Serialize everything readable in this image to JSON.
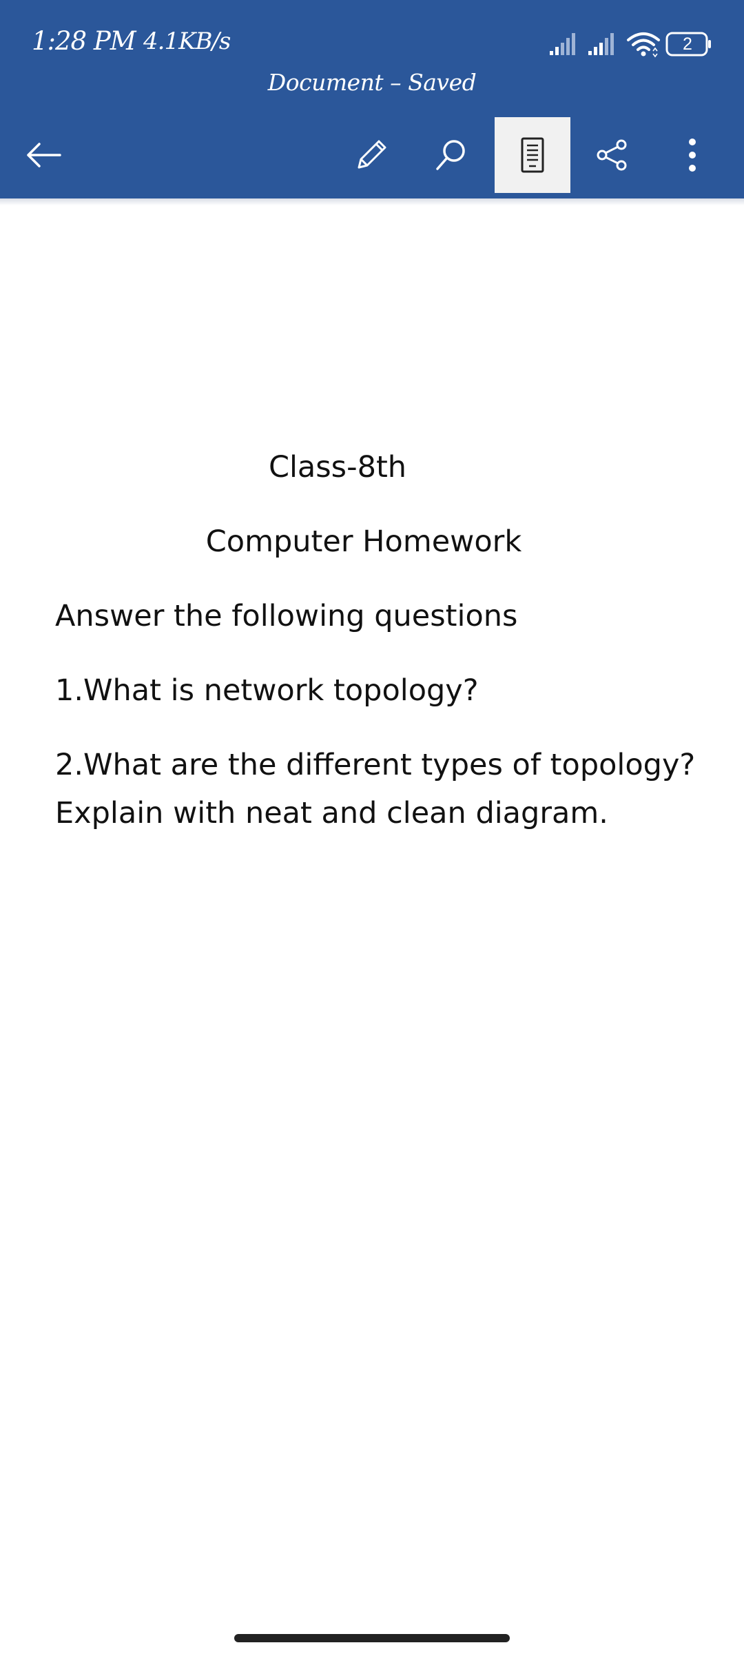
{
  "status_bar": {
    "time": "1:28 PM",
    "network_speed": "4.1KB/s",
    "battery_level": "2"
  },
  "header": {
    "title": "Document – Saved"
  },
  "toolbar": {
    "icons": [
      "back-arrow-icon",
      "pencil-icon",
      "search-icon",
      "mobile-view-icon",
      "share-icon",
      "more-vertical-icon"
    ],
    "active_tab": "mobile-view",
    "accent_color": "#2b579a"
  },
  "document": {
    "lines": [
      "Class-8th",
      "Computer Homework",
      "Answer the following questions",
      "1.What is network topology?",
      "2.What are the different types of topology?",
      "Explain with neat and clean diagram."
    ]
  }
}
